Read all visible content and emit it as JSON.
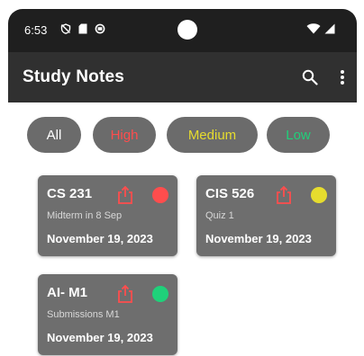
{
  "status_bar": {
    "time": "6:53"
  },
  "app_bar": {
    "title": "Study Notes"
  },
  "filters": [
    {
      "label": "All",
      "color": "#ffffff"
    },
    {
      "label": "High",
      "color": "#ff4d4d"
    },
    {
      "label": "Medium",
      "color": "#e6dc2e"
    },
    {
      "label": "Low",
      "color": "#1fd17a"
    }
  ],
  "notes": [
    {
      "title": "CS 231",
      "subtitle": "Midterm in 8 Sep",
      "date": "November 19, 2023",
      "priority_color": "#ff4d4d"
    },
    {
      "title": "CIS 526",
      "subtitle": "Quiz 1",
      "date": "November 19, 2023",
      "priority_color": "#e6dc2e"
    },
    {
      "title": "AI- M1",
      "subtitle": "Submissions M1",
      "date": "November 19, 2023",
      "priority_color": "#1fd17a"
    }
  ],
  "colors": {
    "share_icon": "#ff4d4d"
  }
}
